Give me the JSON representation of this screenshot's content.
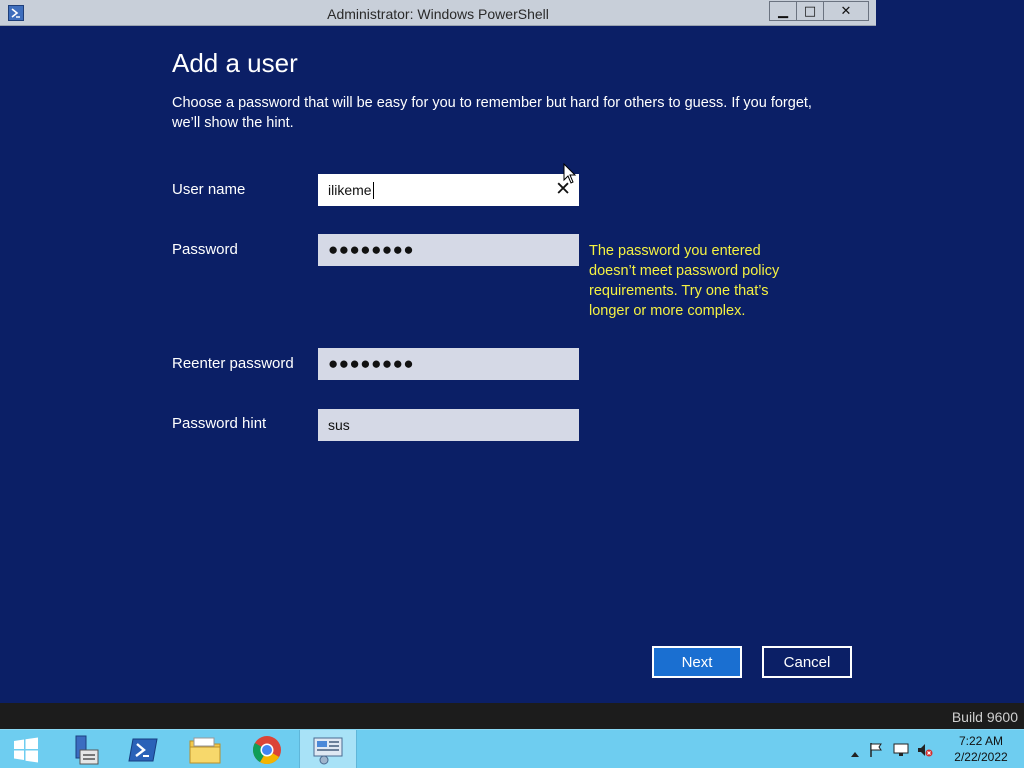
{
  "window": {
    "title": "Administrator: Windows PowerShell",
    "minimize_glyph": "▁",
    "maximize_glyph": "□",
    "close_glyph": "✕"
  },
  "dialog": {
    "heading": "Add a user",
    "description": "Choose a password that will be easy for you to remember but hard for others to guess. If you forget, we’ll show the hint.",
    "fields": {
      "username": {
        "label": "User name",
        "value": "ilikeme"
      },
      "password": {
        "label": "Password",
        "value": "●●●●●●●●"
      },
      "reenter": {
        "label": "Reenter password",
        "value": "●●●●●●●●"
      },
      "hint": {
        "label": "Password hint",
        "value": "sus"
      }
    },
    "clear_glyph": "✕",
    "error": "The password you entered doesn’t meet password policy requirements. Try one that’s longer or more complex.",
    "next_label": "Next",
    "cancel_label": "Cancel",
    "colors": {
      "background": "#0b1f66",
      "error": "#f4f142",
      "primary_button": "#1a6fd1"
    }
  },
  "build": "Build 9600",
  "taskbar": {
    "items": [
      "start-icon",
      "server-manager-icon",
      "powershell-icon",
      "file-explorer-icon",
      "chrome-icon",
      "control-panel-icon"
    ],
    "tray": {
      "time": "7:22 AM",
      "date": "2/22/2022"
    }
  }
}
